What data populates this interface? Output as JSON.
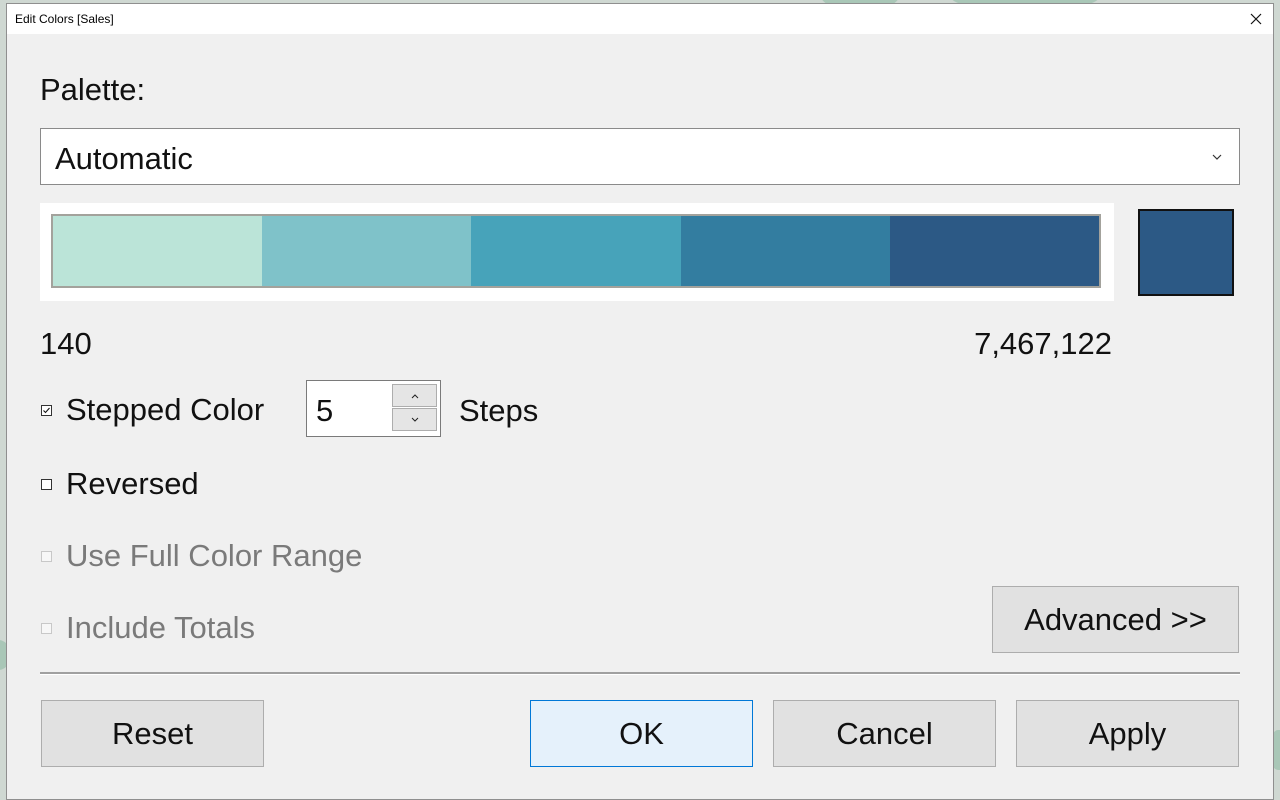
{
  "window": {
    "title": "Edit Colors [Sales]"
  },
  "palette": {
    "label": "Palette:",
    "selected": "Automatic"
  },
  "ramp": {
    "colors": [
      "#bbe4d8",
      "#7fc2c9",
      "#47a3ba",
      "#337da0",
      "#2c5985"
    ],
    "end_swatch_color": "#2c5985",
    "min_value": "140",
    "max_value": "7,467,122"
  },
  "options": {
    "stepped_color": {
      "label": "Stepped Color",
      "checked": true
    },
    "steps": {
      "value": "5",
      "label": "Steps"
    },
    "reversed": {
      "label": "Reversed",
      "checked": false
    },
    "use_full_color_range": {
      "label": "Use Full Color Range",
      "checked": false,
      "enabled": false
    },
    "include_totals": {
      "label": "Include Totals",
      "checked": false,
      "enabled": false
    }
  },
  "buttons": {
    "advanced": "Advanced >>",
    "reset": "Reset",
    "ok": "OK",
    "cancel": "Cancel",
    "apply": "Apply"
  },
  "icons": {
    "close": "close-icon",
    "dropdown": "chevron-down-icon",
    "spin_up": "caret-up-icon",
    "spin_down": "caret-down-icon",
    "checkmark": "checkmark-icon"
  }
}
